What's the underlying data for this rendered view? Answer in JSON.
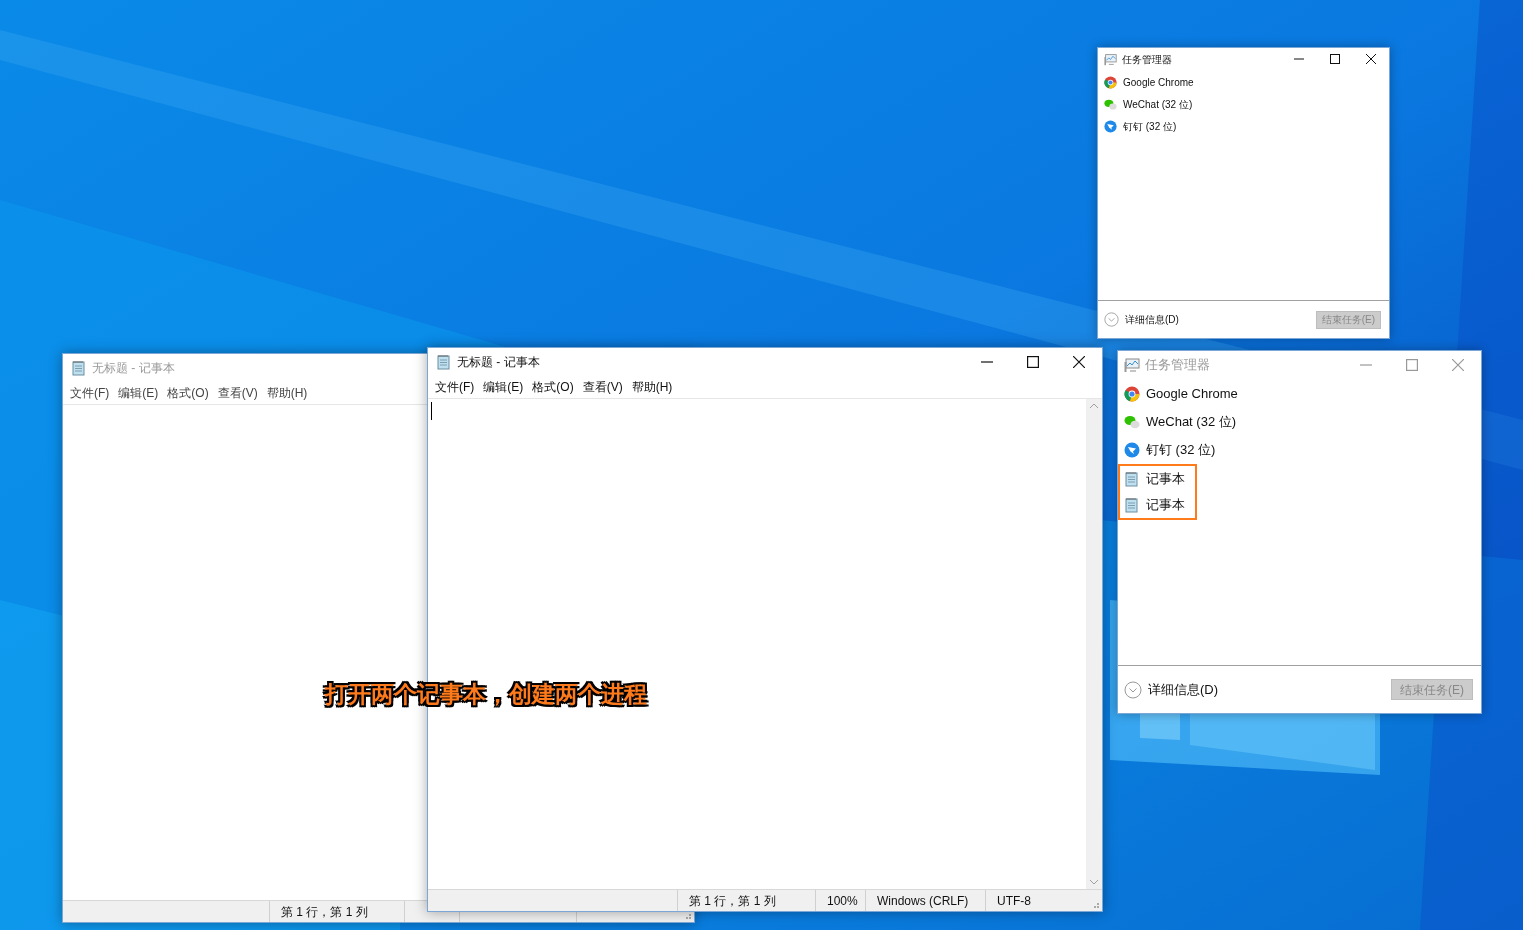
{
  "notepad_windows": [
    {
      "title": "无标题 - 记事本",
      "active": false,
      "menu": [
        "文件(F)",
        "编辑(E)",
        "格式(O)",
        "查看(V)",
        "帮助(H)"
      ],
      "status_bar": [
        "第 1 行，第 1 列"
      ]
    },
    {
      "title": "无标题 - 记事本",
      "active": true,
      "menu": [
        "文件(F)",
        "编辑(E)",
        "格式(O)",
        "查看(V)",
        "帮助(H)"
      ],
      "status_bar": [
        "第 1 行，第 1 列",
        "100%",
        "Windows (CRLF)",
        "UTF-8"
      ]
    }
  ],
  "task_manager_windows": [
    {
      "title": "任务管理器",
      "active": true,
      "processes": [
        {
          "kind": "chrome",
          "name": "Google Chrome",
          "highlighted": false
        },
        {
          "kind": "wechat",
          "name": "WeChat (32 位)",
          "highlighted": false
        },
        {
          "kind": "dingtalk",
          "name": "钉钉 (32 位)",
          "highlighted": false
        }
      ],
      "details_label": "详细信息(D)",
      "end_task_label": "结束任务(E)"
    },
    {
      "title": "任务管理器",
      "active": false,
      "processes": [
        {
          "kind": "chrome",
          "name": "Google Chrome",
          "highlighted": false
        },
        {
          "kind": "wechat",
          "name": "WeChat (32 位)",
          "highlighted": false
        },
        {
          "kind": "dingtalk",
          "name": "钉钉 (32 位)",
          "highlighted": false
        },
        {
          "kind": "notepad",
          "name": "记事本",
          "highlighted": true
        },
        {
          "kind": "notepad",
          "name": "记事本",
          "highlighted": true
        }
      ],
      "details_label": "详细信息(D)",
      "end_task_label": "结束任务(E)"
    }
  ],
  "caption": "打开两个记事本，创建两个进程"
}
